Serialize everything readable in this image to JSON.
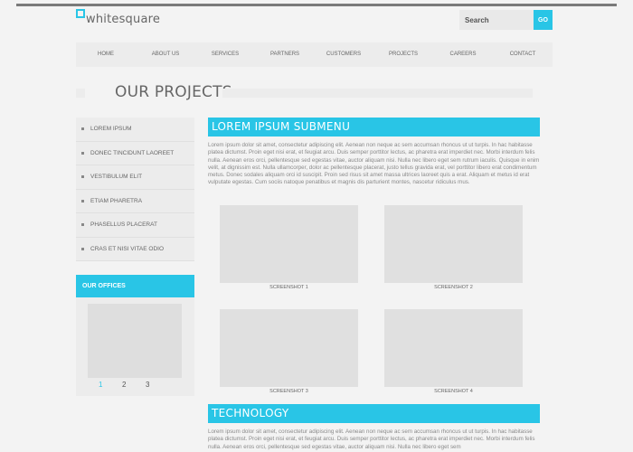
{
  "header": {
    "logo_text": "whitesquare",
    "search_placeholder": "Search",
    "go_label": "GO",
    "accent_color": "#29c5e6"
  },
  "nav": {
    "items": [
      "HOME",
      "ABOUT US",
      "SERVICES",
      "PARTNERS",
      "CUSTOMERS",
      "PROJECTS",
      "CAREERS",
      "CONTACT"
    ]
  },
  "page_title": "OUR PROJECTS",
  "sidebar": {
    "items": [
      {
        "label": "LOREM IPSUM"
      },
      {
        "label": "DONEC TINCIDUNT LAOREET"
      },
      {
        "label": "VESTIBULUM ELIT"
      },
      {
        "label": "ETIAM PHARETRA"
      },
      {
        "label": "PHASELLUS PLACERAT"
      },
      {
        "label": "CRAS ET NISI VITAE ODIO"
      }
    ]
  },
  "offices": {
    "title": "OUR OFFICES",
    "pages": [
      "1",
      "2",
      "3"
    ],
    "active_page": "1"
  },
  "main": {
    "submenu_title": "LOREM IPSUM SUBMENU",
    "intro": "Lorem ipsum dolor sit amet, consectetur adipiscing elit. Aenean non neque ac sem accumsan rhoncus ut ut turpis. In hac habitasse platea dictumst. Proin eget nisi erat, et feugiat arcu. Duis semper porttitor lectus, ac pharetra erat imperdiet nec. Morbi interdum felis nulla. Aenean eros orci, pellentesque sed egestas vitae, auctor aliquam nisi. Nulla nec libero eget sem rutrum iaculis. Quisque in enim velit, at dignissim est. Nulla ullamcorper, dolor ac pellentesque placerat, justo tellus gravida erat, vel porttitor libero erat condimentum metus. Donec sodales aliquam orci id suscipit. Proin sed risus sit amet massa ultrices laoreet quis a erat. Aliquam et metus id erat vulputate egestas. Cum sociis natoque penatibus et magnis dis parturient montes, nascetur ridiculus mus.",
    "screenshots": [
      {
        "caption": "SCREENSHOT 1"
      },
      {
        "caption": "SCREENSHOT 2"
      },
      {
        "caption": "SCREENSHOT 3"
      },
      {
        "caption": "SCREENSHOT 4"
      }
    ],
    "tech_title": "TECHNOLOGY",
    "tech_text": "Lorem ipsum dolor sit amet, consectetur adipiscing elit. Aenean non neque ac sem accumsan rhoncus ut ut turpis. In hac habitasse platea dictumst. Proin eget nisi erat, et feugiat arcu. Duis semper porttitor lectus, ac pharetra erat imperdiet nec. Morbi interdum felis nulla. Aenean eros orci, pellentesque sed egestas vitae, auctor aliquam nisi. Nulla nec libero eget sem"
  }
}
